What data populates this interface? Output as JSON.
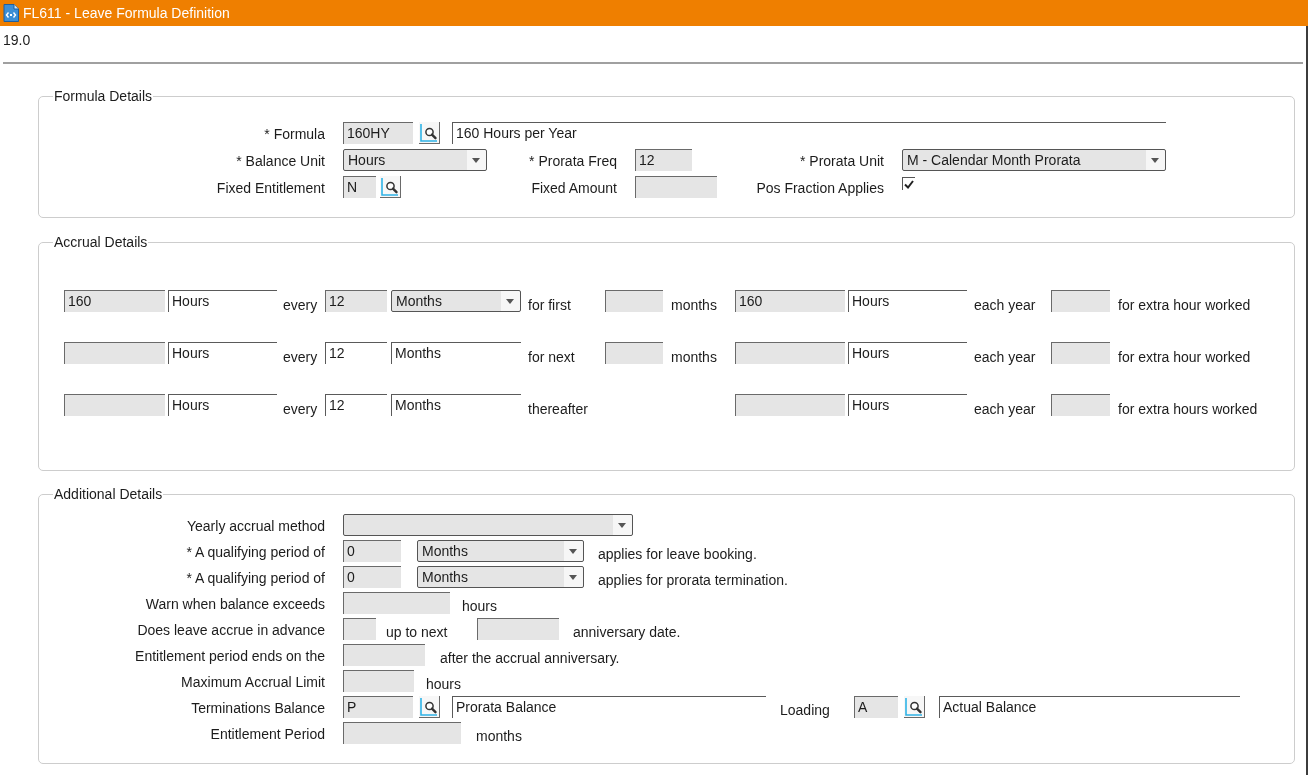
{
  "window": {
    "title": "FL611 - Leave Formula Definition"
  },
  "version": "19.0",
  "sections": [
    {
      "title": "Formula Details",
      "rows": [
        {
          "label": "* Formula",
          "items": [
            {
              "kind": "input",
              "value": "160HY"
            },
            {
              "kind": "lookup"
            },
            {
              "kind": "display",
              "value": "160 Hours per Year"
            }
          ]
        },
        {
          "label": "* Balance Unit",
          "items": [
            {
              "kind": "select",
              "value": "Hours"
            },
            {
              "kind": "label",
              "text": "* Prorata Freq"
            },
            {
              "kind": "input",
              "value": "12"
            },
            {
              "kind": "label",
              "text": "* Prorata Unit"
            },
            {
              "kind": "select",
              "value": "M - Calendar Month Prorata"
            }
          ]
        },
        {
          "label": "Fixed Entitlement",
          "items": [
            {
              "kind": "input",
              "value": "N"
            },
            {
              "kind": "lookup"
            },
            {
              "kind": "label",
              "text": "Fixed Amount"
            },
            {
              "kind": "input"
            },
            {
              "kind": "label",
              "text": "Pos Fraction Applies"
            },
            {
              "kind": "checkbox",
              "checked": true
            }
          ]
        }
      ]
    },
    {
      "title": "Accrual Details",
      "rows": [
        {
          "items": [
            {
              "kind": "input",
              "value": "160"
            },
            {
              "kind": "display",
              "value": "Hours"
            },
            {
              "kind": "text",
              "text": "every"
            },
            {
              "kind": "input",
              "value": "12"
            },
            {
              "kind": "select",
              "value": "Months"
            },
            {
              "kind": "text",
              "text": "for first"
            },
            {
              "kind": "input"
            },
            {
              "kind": "text",
              "text": "months"
            },
            {
              "kind": "input",
              "value": "160"
            },
            {
              "kind": "display",
              "value": "Hours"
            },
            {
              "kind": "text",
              "text": "each year"
            },
            {
              "kind": "input"
            },
            {
              "kind": "text",
              "text": "for extra hour worked"
            }
          ]
        },
        {
          "items": [
            {
              "kind": "input"
            },
            {
              "kind": "display",
              "value": "Hours"
            },
            {
              "kind": "text",
              "text": "every"
            },
            {
              "kind": "display",
              "value": "12"
            },
            {
              "kind": "display",
              "value": "Months"
            },
            {
              "kind": "text",
              "text": "for next"
            },
            {
              "kind": "input"
            },
            {
              "kind": "text",
              "text": "months"
            },
            {
              "kind": "input"
            },
            {
              "kind": "display",
              "value": "Hours"
            },
            {
              "kind": "text",
              "text": "each year"
            },
            {
              "kind": "input"
            },
            {
              "kind": "text",
              "text": "for extra hour worked"
            }
          ]
        },
        {
          "items": [
            {
              "kind": "input"
            },
            {
              "kind": "display",
              "value": "Hours"
            },
            {
              "kind": "text",
              "text": "every"
            },
            {
              "kind": "display",
              "value": "12"
            },
            {
              "kind": "display",
              "value": "Months"
            },
            {
              "kind": "text",
              "text": "thereafter"
            },
            {
              "kind": "input"
            },
            {
              "kind": "display",
              "value": "Hours"
            },
            {
              "kind": "text",
              "text": "each year"
            },
            {
              "kind": "input"
            },
            {
              "kind": "text",
              "text": "for extra hours worked"
            }
          ]
        }
      ]
    },
    {
      "title": "Additional Details",
      "rows": [
        {
          "label": "Yearly accrual method",
          "items": [
            {
              "kind": "select"
            }
          ]
        },
        {
          "label": "* A qualifying period of",
          "items": [
            {
              "kind": "input",
              "value": "0"
            },
            {
              "kind": "select",
              "value": "Months"
            },
            {
              "kind": "text",
              "text": "applies for leave booking."
            }
          ]
        },
        {
          "label": "* A qualifying period of",
          "items": [
            {
              "kind": "input",
              "value": "0"
            },
            {
              "kind": "select",
              "value": "Months"
            },
            {
              "kind": "text",
              "text": "applies for prorata termination."
            }
          ]
        },
        {
          "label": "Warn when balance exceeds",
          "items": [
            {
              "kind": "input"
            },
            {
              "kind": "text",
              "text": "hours"
            }
          ]
        },
        {
          "label": "Does leave accrue in advance",
          "items": [
            {
              "kind": "input"
            },
            {
              "kind": "text",
              "text": "up to next"
            },
            {
              "kind": "input"
            },
            {
              "kind": "text",
              "text": "anniversary date."
            }
          ]
        },
        {
          "label": "Entitlement period ends on the",
          "items": [
            {
              "kind": "input"
            },
            {
              "kind": "text",
              "text": "after the accrual anniversary."
            }
          ]
        },
        {
          "label": "Maximum Accrual Limit",
          "items": [
            {
              "kind": "input"
            },
            {
              "kind": "text",
              "text": "hours"
            }
          ]
        },
        {
          "label": "Terminations Balance",
          "items": [
            {
              "kind": "input",
              "value": "P"
            },
            {
              "kind": "lookup"
            },
            {
              "kind": "display",
              "value": "Prorata Balance"
            },
            {
              "kind": "text",
              "text": "Loading"
            },
            {
              "kind": "input",
              "value": "A"
            },
            {
              "kind": "lookup"
            },
            {
              "kind": "display",
              "value": "Actual Balance"
            }
          ]
        },
        {
          "label": "Entitlement Period",
          "items": [
            {
              "kind": "input"
            },
            {
              "kind": "text",
              "text": "months"
            }
          ]
        }
      ]
    }
  ]
}
